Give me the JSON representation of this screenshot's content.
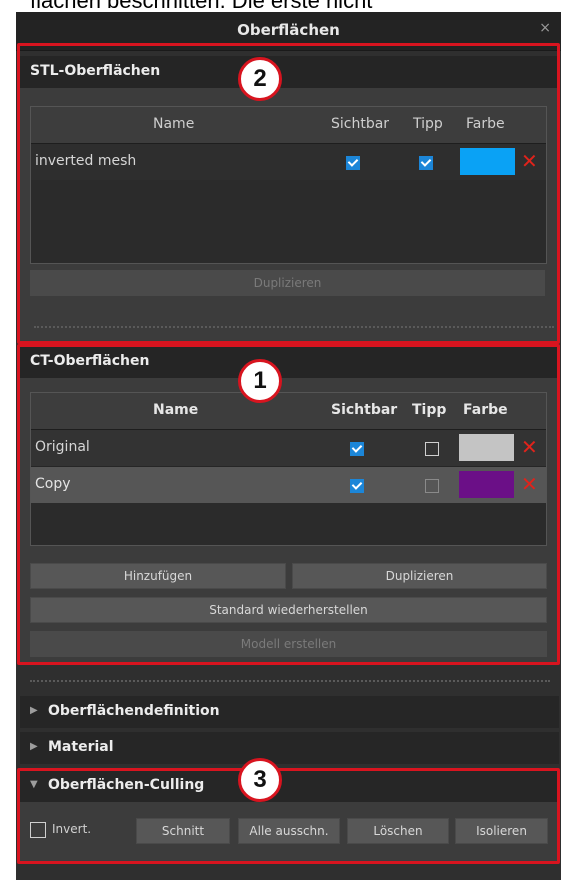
{
  "top_caption": "flächen beschnitten. Die erste nicht",
  "window": {
    "title": "Oberflächen",
    "close_icon": "×"
  },
  "stl_section": {
    "title": "STL-Oberflächen",
    "columns": [
      "Name",
      "Sichtbar",
      "Tipp",
      "Farbe"
    ],
    "rows": [
      {
        "name": "inverted mesh",
        "visible": true,
        "tip": true,
        "color": "#0aa2f5"
      }
    ],
    "duplicate_label": "Duplizieren"
  },
  "ct_section": {
    "title": "CT-Oberflächen",
    "columns": [
      "Name",
      "Sichtbar",
      "Tipp",
      "Farbe"
    ],
    "rows": [
      {
        "name": "Original",
        "visible": true,
        "tip": false,
        "color": "#c4c4c4"
      },
      {
        "name": "Copy",
        "visible": true,
        "tip": false,
        "color": "#6b0f87"
      }
    ],
    "add_label": "Hinzufügen",
    "duplicate_label": "Duplizieren",
    "restore_label": "Standard wiederherstellen",
    "create_model_label": "Modell erstellen"
  },
  "accordions": {
    "definition": "Oberflächendefinition",
    "material": "Material",
    "culling": "Oberflächen-Culling"
  },
  "culling": {
    "invert_label": "Invert.",
    "invert_checked": false,
    "buttons": [
      "Schnitt",
      "Alle ausschn.",
      "Löschen",
      "Isolieren"
    ]
  },
  "badges": [
    "2",
    "1",
    "3"
  ],
  "colors": {
    "highlight": "#d8141f",
    "checkbox": "#1c86d8",
    "delete": "#e0231b"
  }
}
